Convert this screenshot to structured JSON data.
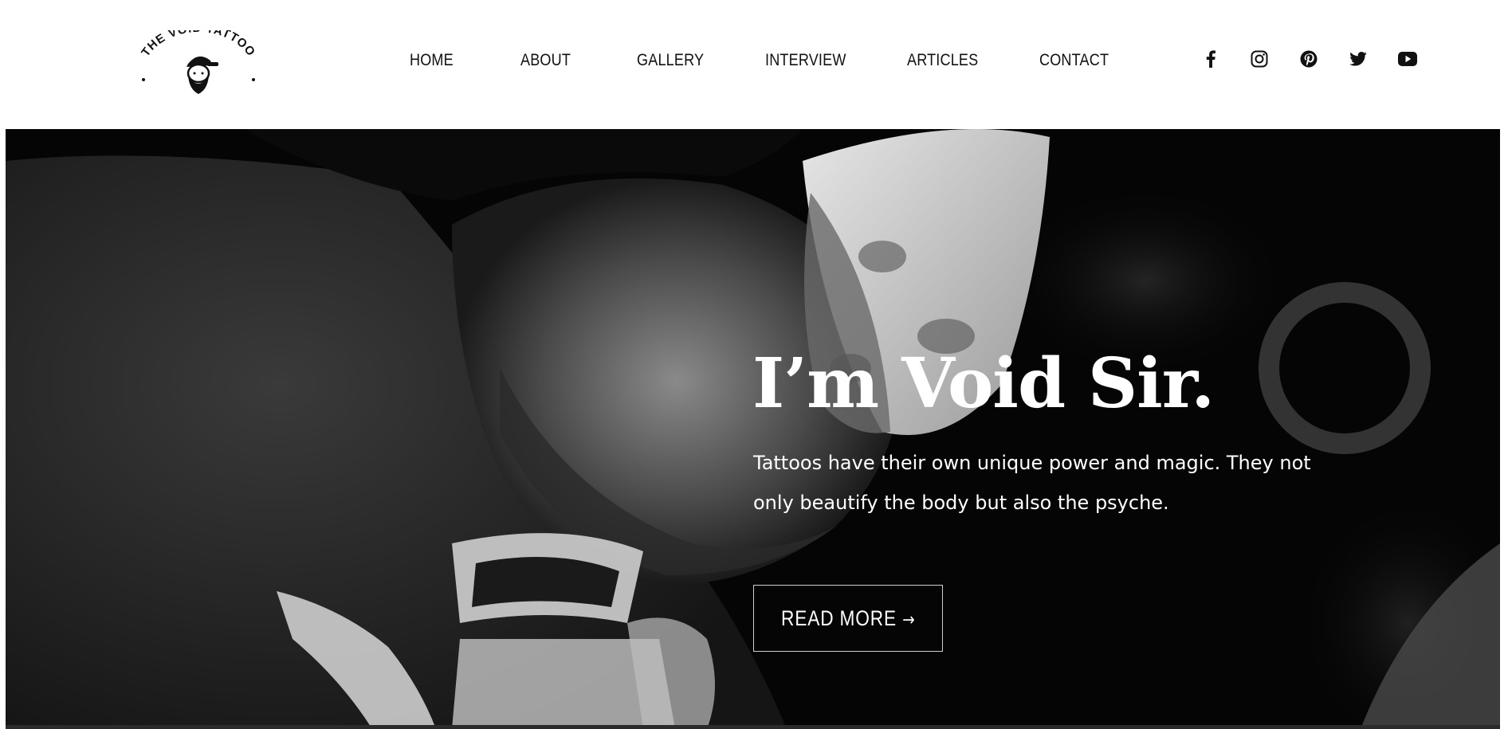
{
  "header": {
    "logo": {
      "text": "THE VOID TATTOO"
    },
    "nav": [
      {
        "label": "HOME"
      },
      {
        "label": "ABOUT"
      },
      {
        "label": "GALLERY"
      },
      {
        "label": "INTERVIEW"
      },
      {
        "label": "ARTICLES"
      },
      {
        "label": "CONTACT"
      }
    ],
    "social": [
      {
        "icon": "facebook-icon"
      },
      {
        "icon": "instagram-icon"
      },
      {
        "icon": "pinterest-icon"
      },
      {
        "icon": "twitter-icon"
      },
      {
        "icon": "youtube-icon"
      }
    ]
  },
  "hero": {
    "title": "I’m Void Sir.",
    "text_line_1": "Tattoos have their own unique power and magic. They not",
    "text_line_2": "only beautify the body but also the psyche.",
    "button_label": "READ MORE",
    "button_arrow": "→",
    "photo_tone": "black-and-white"
  },
  "colors": {
    "header_bg": "#ffffff",
    "nav_text": "#111111",
    "hero_bg": "#050505",
    "hero_text": "#ffffff",
    "button_border": "#cfcfcf"
  }
}
